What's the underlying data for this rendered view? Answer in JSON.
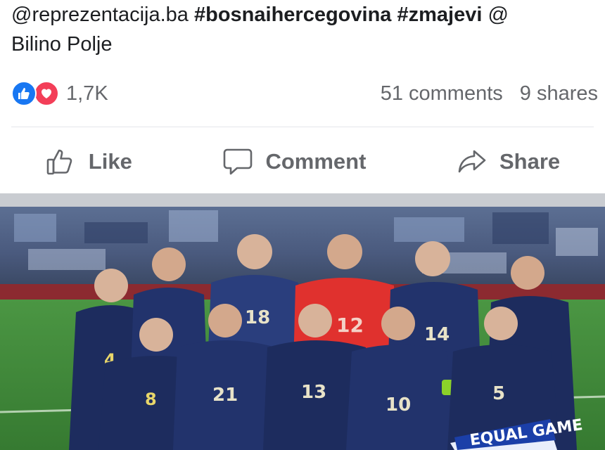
{
  "post": {
    "caption_handle": "@reprezentacija.ba",
    "caption_tag1": "#bosnaihercegovina",
    "caption_tag2": "#zmajevi",
    "caption_at": "@",
    "caption_location": "Bilino Polje"
  },
  "stats": {
    "reactions_count": "1,7K",
    "comments": "51 comments",
    "shares": "9 shares",
    "reaction_icons": [
      "thumbs-up-icon",
      "heart-icon"
    ]
  },
  "actions": {
    "like": "Like",
    "comment": "Comment",
    "share": "Share"
  },
  "photo": {
    "jersey_numbers": [
      "4",
      "18",
      "12",
      "14",
      "8",
      "21",
      "13",
      "10",
      "5"
    ],
    "banner_text": "EQUAL GAME"
  },
  "colors": {
    "facebook_blue": "#1877f2",
    "love_red": "#f33e58",
    "secondary_text": "#65676b",
    "kit_navy": "#1d2c5e",
    "keeper_red": "#e0312e",
    "pitch_green": "#3f8a3a"
  }
}
